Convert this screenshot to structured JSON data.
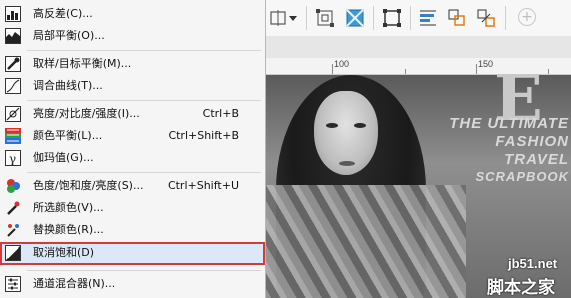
{
  "menu": {
    "items": [
      {
        "label": "高反差(C)...",
        "shortcut": ""
      },
      {
        "label": "局部平衡(O)...",
        "shortcut": ""
      },
      {
        "label": "取样/目标平衡(M)...",
        "shortcut": ""
      },
      {
        "label": "调合曲线(T)...",
        "shortcut": ""
      },
      {
        "label": "亮度/对比度/强度(I)...",
        "shortcut": "Ctrl+B"
      },
      {
        "label": "颜色平衡(L)...",
        "shortcut": "Ctrl+Shift+B"
      },
      {
        "label": "伽玛值(G)...",
        "shortcut": ""
      },
      {
        "label": "色度/饱和度/亮度(S)...",
        "shortcut": "Ctrl+Shift+U"
      },
      {
        "label": "所选颜色(V)...",
        "shortcut": ""
      },
      {
        "label": "替换颜色(R)...",
        "shortcut": ""
      },
      {
        "label": "取消饱和(D)",
        "shortcut": ""
      },
      {
        "label": "通道混合器(N)...",
        "shortcut": ""
      }
    ],
    "selected_index": 10,
    "highlight_color": "#d33b3b"
  },
  "toolbar": {
    "icons": [
      "mirror-icon",
      "dropdown-arrow-icon",
      "node-align-icon",
      "bitmap-mask-icon",
      "frame-icon",
      "align-icon",
      "group-icon",
      "ungroup-icon",
      "add-icon"
    ]
  },
  "ruler": {
    "labels": [
      "100",
      "150"
    ]
  },
  "cover": {
    "big_letter": "E",
    "lines": [
      "THE ULTIMATE",
      "FASHION",
      "TRAVEL",
      "SCRAPBOOK"
    ]
  },
  "watermark": {
    "site": "jb51.net",
    "brand": "脚本之家"
  }
}
